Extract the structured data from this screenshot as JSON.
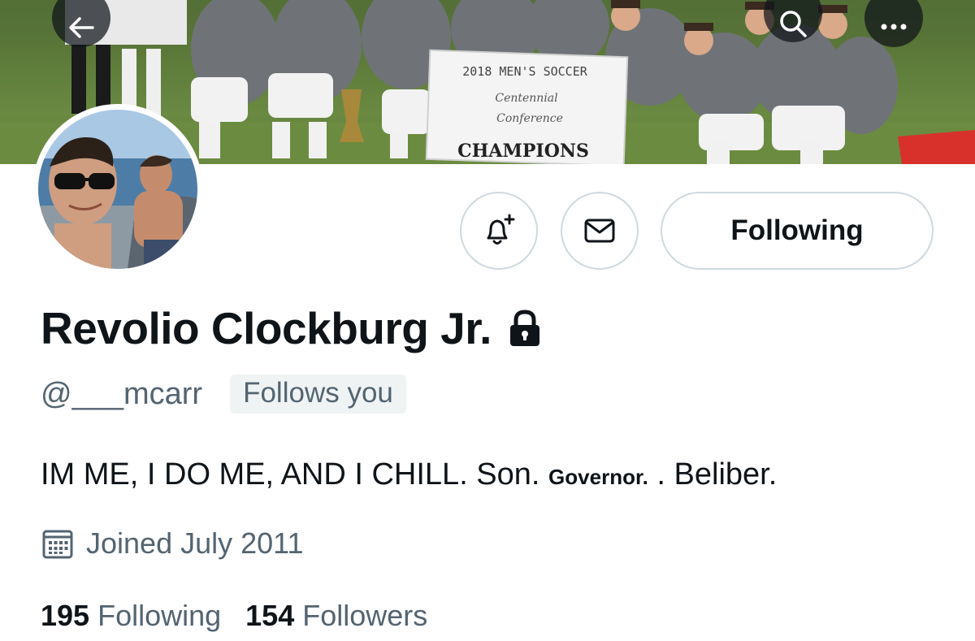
{
  "header": {
    "back_icon": "arrow-left-icon",
    "search_icon": "search-icon",
    "more_icon": "more-horizontal-icon"
  },
  "banner": {
    "sign_line1": "2018 MEN'S SOCCER",
    "sign_line2": "Centennial",
    "sign_line3": "Conference",
    "sign_line4": "CHAMPIONS"
  },
  "actions": {
    "notify_icon": "bell-plus-icon",
    "message_icon": "envelope-icon",
    "following_label": "Following"
  },
  "profile": {
    "display_name": "Revolio Clockburg Jr.",
    "protected_icon": "lock-icon",
    "handle": "@___mcarr",
    "follows_you_label": "Follows you",
    "bio_part1": "IM ME, I DO ME, AND I CHILL. Son. ",
    "bio_part2": "Governor.",
    "bio_part3": " . Beliber.",
    "joined_icon": "calendar-icon",
    "joined": "Joined July 2011"
  },
  "stats": {
    "following_count": "195",
    "following_label": "Following",
    "followers_count": "154",
    "followers_label": "Followers"
  },
  "colors": {
    "text_primary": "#0f1419",
    "text_secondary": "#536471",
    "border": "#cfd9de",
    "badge_bg": "#eff3f4"
  }
}
